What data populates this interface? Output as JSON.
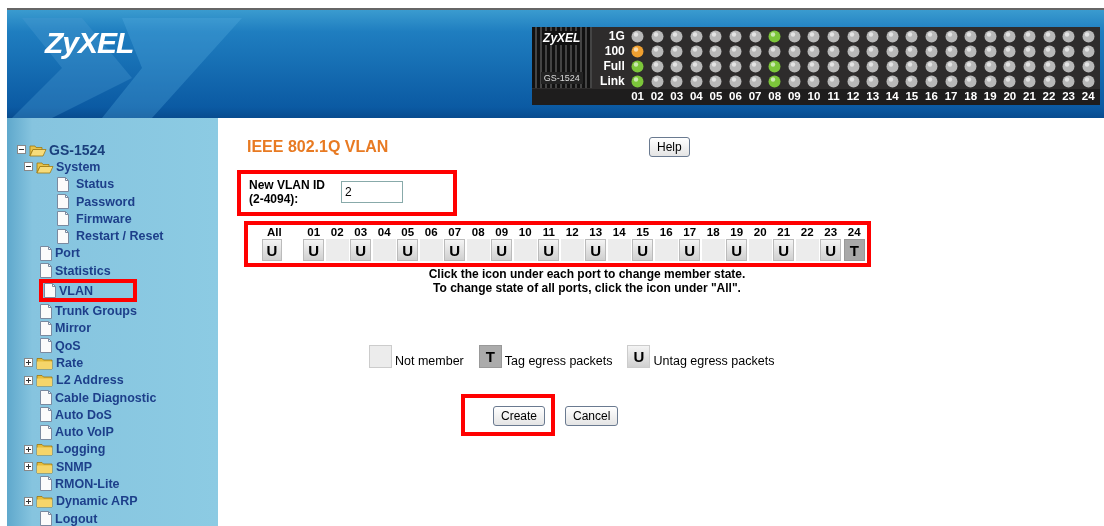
{
  "header": {
    "logo": "ZyXEL",
    "device": {
      "logo": "ZyXEL",
      "model": "GS-1524",
      "led_rows": [
        {
          "label": "1G",
          "leds": [
            {
              "color": "#b8b8b8"
            },
            {
              "color": "#b8b8b8"
            },
            {
              "color": "#b8b8b8"
            },
            {
              "color": "#b8b8b8"
            },
            {
              "color": "#b8b8b8"
            },
            {
              "color": "#b8b8b8"
            },
            {
              "color": "#b8b8b8"
            },
            {
              "color": "#7cc63a"
            },
            {
              "color": "#b8b8b8"
            },
            {
              "color": "#b8b8b8"
            },
            {
              "color": "#b8b8b8"
            },
            {
              "color": "#b8b8b8"
            },
            {
              "color": "#b8b8b8"
            },
            {
              "color": "#b8b8b8"
            },
            {
              "color": "#b8b8b8"
            },
            {
              "color": "#b8b8b8"
            },
            {
              "color": "#b8b8b8"
            },
            {
              "color": "#b8b8b8"
            },
            {
              "color": "#b8b8b8"
            },
            {
              "color": "#b8b8b8"
            },
            {
              "color": "#b8b8b8"
            },
            {
              "color": "#b8b8b8"
            },
            {
              "color": "#b8b8b8"
            },
            {
              "color": "#b8b8b8"
            }
          ]
        },
        {
          "label": "100",
          "leds": [
            {
              "color": "#f0a030"
            },
            {
              "color": "#b8b8b8"
            },
            {
              "color": "#b8b8b8"
            },
            {
              "color": "#b8b8b8"
            },
            {
              "color": "#b8b8b8"
            },
            {
              "color": "#b8b8b8"
            },
            {
              "color": "#b8b8b8"
            },
            {
              "color": "#b8b8b8"
            },
            {
              "color": "#b8b8b8"
            },
            {
              "color": "#b8b8b8"
            },
            {
              "color": "#b8b8b8"
            },
            {
              "color": "#b8b8b8"
            },
            {
              "color": "#b8b8b8"
            },
            {
              "color": "#b8b8b8"
            },
            {
              "color": "#b8b8b8"
            },
            {
              "color": "#b8b8b8"
            },
            {
              "color": "#b8b8b8"
            },
            {
              "color": "#b8b8b8"
            },
            {
              "color": "#b8b8b8"
            },
            {
              "color": "#b8b8b8"
            },
            {
              "color": "#b8b8b8"
            },
            {
              "color": "#b8b8b8"
            },
            {
              "color": "#b8b8b8"
            },
            {
              "color": "#b8b8b8"
            }
          ]
        },
        {
          "label": "Full",
          "leds": [
            {
              "color": "#7cc63a"
            },
            {
              "color": "#b8b8b8"
            },
            {
              "color": "#b8b8b8"
            },
            {
              "color": "#b8b8b8"
            },
            {
              "color": "#b8b8b8"
            },
            {
              "color": "#b8b8b8"
            },
            {
              "color": "#b8b8b8"
            },
            {
              "color": "#7cc63a"
            },
            {
              "color": "#b8b8b8"
            },
            {
              "color": "#b8b8b8"
            },
            {
              "color": "#b8b8b8"
            },
            {
              "color": "#b8b8b8"
            },
            {
              "color": "#b8b8b8"
            },
            {
              "color": "#b8b8b8"
            },
            {
              "color": "#b8b8b8"
            },
            {
              "color": "#b8b8b8"
            },
            {
              "color": "#b8b8b8"
            },
            {
              "color": "#b8b8b8"
            },
            {
              "color": "#b8b8b8"
            },
            {
              "color": "#b8b8b8"
            },
            {
              "color": "#b8b8b8"
            },
            {
              "color": "#b8b8b8"
            },
            {
              "color": "#b8b8b8"
            },
            {
              "color": "#b8b8b8"
            }
          ]
        },
        {
          "label": "Link",
          "leds": [
            {
              "color": "#7cc63a"
            },
            {
              "color": "#b8b8b8"
            },
            {
              "color": "#b8b8b8"
            },
            {
              "color": "#b8b8b8"
            },
            {
              "color": "#b8b8b8"
            },
            {
              "color": "#b8b8b8"
            },
            {
              "color": "#b8b8b8"
            },
            {
              "color": "#7cc63a"
            },
            {
              "color": "#b8b8b8"
            },
            {
              "color": "#b8b8b8"
            },
            {
              "color": "#b8b8b8"
            },
            {
              "color": "#b8b8b8"
            },
            {
              "color": "#b8b8b8"
            },
            {
              "color": "#b8b8b8"
            },
            {
              "color": "#b8b8b8"
            },
            {
              "color": "#b8b8b8"
            },
            {
              "color": "#b8b8b8"
            },
            {
              "color": "#b8b8b8"
            },
            {
              "color": "#b8b8b8"
            },
            {
              "color": "#b8b8b8"
            },
            {
              "color": "#b8b8b8"
            },
            {
              "color": "#b8b8b8"
            },
            {
              "color": "#b8b8b8"
            },
            {
              "color": "#b8b8b8"
            }
          ]
        }
      ],
      "port_numbers": [
        "01",
        "02",
        "03",
        "04",
        "05",
        "06",
        "07",
        "08",
        "09",
        "10",
        "11",
        "12",
        "13",
        "14",
        "15",
        "16",
        "17",
        "18",
        "19",
        "20",
        "21",
        "22",
        "23",
        "24"
      ]
    }
  },
  "sidebar": {
    "tree": [
      {
        "label": "GS-1524",
        "kind": "folder",
        "expanded": true,
        "children": [
          {
            "label": "System",
            "kind": "folder",
            "expanded": true,
            "children": [
              {
                "label": "Status",
                "kind": "page"
              },
              {
                "label": "Password",
                "kind": "page"
              },
              {
                "label": "Firmware",
                "kind": "page"
              },
              {
                "label": "Restart / Reset",
                "kind": "page"
              }
            ]
          },
          {
            "label": "Port",
            "kind": "page"
          },
          {
            "label": "Statistics",
            "kind": "page"
          },
          {
            "label": "VLAN",
            "kind": "page",
            "highlighted": true
          },
          {
            "label": "Trunk Groups",
            "kind": "page"
          },
          {
            "label": "Mirror",
            "kind": "page"
          },
          {
            "label": "QoS",
            "kind": "page"
          },
          {
            "label": "Rate",
            "kind": "folder",
            "expanded": false
          },
          {
            "label": "L2 Address",
            "kind": "folder",
            "expanded": false
          },
          {
            "label": "Cable Diagnostic",
            "kind": "page"
          },
          {
            "label": "Auto DoS",
            "kind": "page"
          },
          {
            "label": "Auto VoIP",
            "kind": "page"
          },
          {
            "label": "Logging",
            "kind": "folder",
            "expanded": false
          },
          {
            "label": "SNMP",
            "kind": "folder",
            "expanded": false
          },
          {
            "label": "RMON-Lite",
            "kind": "page"
          },
          {
            "label": "Dynamic ARP",
            "kind": "folder",
            "expanded": false
          },
          {
            "label": "Logout",
            "kind": "page"
          }
        ]
      }
    ]
  },
  "content": {
    "title": "IEEE 802.1Q VLAN",
    "help_button": "Help",
    "vlan_id": {
      "label": "New VLAN ID",
      "hint": "(2-4094):",
      "value": "2"
    },
    "ports": [
      {
        "label": "All",
        "kind": "untag",
        "letter": "U"
      },
      {
        "label": "01",
        "kind": "untag",
        "letter": "U"
      },
      {
        "label": "02",
        "kind": "none"
      },
      {
        "label": "03",
        "kind": "untag",
        "letter": "U"
      },
      {
        "label": "04",
        "kind": "none"
      },
      {
        "label": "05",
        "kind": "untag",
        "letter": "U"
      },
      {
        "label": "06",
        "kind": "none"
      },
      {
        "label": "07",
        "kind": "untag",
        "letter": "U"
      },
      {
        "label": "08",
        "kind": "none"
      },
      {
        "label": "09",
        "kind": "untag",
        "letter": "U"
      },
      {
        "label": "10",
        "kind": "none"
      },
      {
        "label": "11",
        "kind": "untag",
        "letter": "U"
      },
      {
        "label": "12",
        "kind": "none"
      },
      {
        "label": "13",
        "kind": "untag",
        "letter": "U"
      },
      {
        "label": "14",
        "kind": "none"
      },
      {
        "label": "15",
        "kind": "untag",
        "letter": "U"
      },
      {
        "label": "16",
        "kind": "none"
      },
      {
        "label": "17",
        "kind": "untag",
        "letter": "U"
      },
      {
        "label": "18",
        "kind": "none"
      },
      {
        "label": "19",
        "kind": "untag",
        "letter": "U"
      },
      {
        "label": "20",
        "kind": "none"
      },
      {
        "label": "21",
        "kind": "untag",
        "letter": "U"
      },
      {
        "label": "22",
        "kind": "none"
      },
      {
        "label": "23",
        "kind": "untag",
        "letter": "U"
      },
      {
        "label": "24",
        "kind": "tag",
        "letter": "T"
      }
    ],
    "instructions": [
      "Click the icon under each port to change member state.",
      "To change state of all ports, click the icon under \"All\"."
    ],
    "legend": [
      {
        "kind": "none",
        "label": "Not member"
      },
      {
        "kind": "tag",
        "letter": "T",
        "label": "Tag egress packets"
      },
      {
        "kind": "untag",
        "letter": "U",
        "label": "Untag egress packets"
      }
    ],
    "buttons": [
      {
        "label": "Create",
        "highlighted": true
      },
      {
        "label": "Cancel",
        "highlighted": false
      }
    ]
  }
}
